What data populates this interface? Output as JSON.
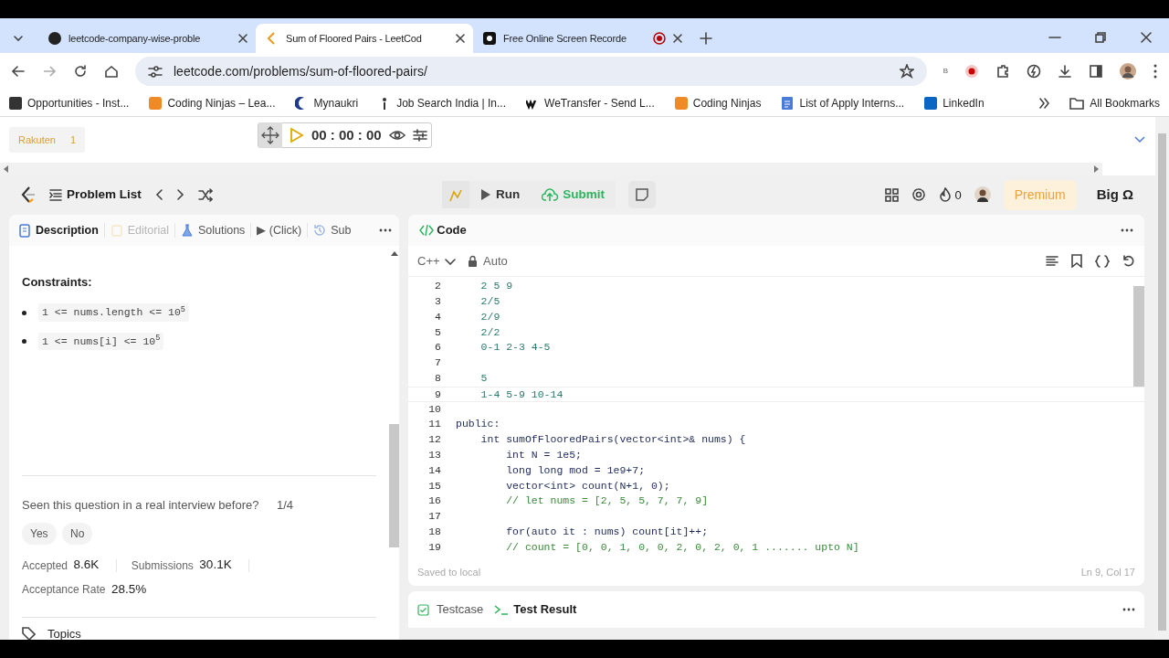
{
  "browser": {
    "tabs": [
      {
        "title": "leetcode-company-wise-proble",
        "selected": false
      },
      {
        "title": "Sum of Floored Pairs - LeetCod",
        "selected": true
      },
      {
        "title": "Free Online Screen Recorde",
        "selected": false
      }
    ],
    "url": "leetcode.com/problems/sum-of-floored-pairs/",
    "extension_badge": "B",
    "bookmarks": [
      "Opportunities - Inst...",
      "Coding Ninjas – Lea...",
      "Mynaukri",
      "Job Search India | In...",
      "WeTransfer - Send L...",
      "Coding Ninjas",
      "List of Apply Interns...",
      "LinkedIn"
    ],
    "all_bookmarks": "All Bookmarks"
  },
  "extension_bar": {
    "chip": {
      "label": "Rakuten",
      "count": "1"
    },
    "timer": "00 : 00 : 00"
  },
  "header": {
    "problem_list": "Problem List",
    "run": "Run",
    "submit": "Submit",
    "streak": "0",
    "premium": "Premium",
    "brand": "Big Ω"
  },
  "left_panel": {
    "tabs": [
      {
        "label": "Description",
        "selected": true,
        "disabled": false
      },
      {
        "label": "Editorial",
        "selected": false,
        "disabled": true
      },
      {
        "label": "Solutions",
        "selected": false,
        "disabled": false
      },
      {
        "label": "▶ (Click)",
        "selected": false,
        "disabled": false
      },
      {
        "label": "Sub",
        "selected": false,
        "disabled": false
      }
    ],
    "constraints_title": "Constraints:",
    "constraints": [
      "1 <= nums.length <= 10$^{5}$",
      "1 <= nums[i] <= 10$^{5}$"
    ],
    "interview_question": "Seen this question in a real interview before?",
    "interview_count": "1/4",
    "answers": [
      "Yes",
      "No"
    ],
    "stats": [
      {
        "label": "Accepted",
        "value": "8.6K"
      },
      {
        "label": "Submissions",
        "value": "30.1K"
      },
      {
        "label": "Acceptance Rate",
        "value": "28.5%"
      }
    ],
    "topics": "Topics"
  },
  "code_panel": {
    "title": "Code",
    "language": "C++",
    "mode": "Auto",
    "lines": [
      {
        "number": "2",
        "text": "    2 5 9",
        "kind": "note",
        "active": false
      },
      {
        "number": "3",
        "text": "    2/5",
        "kind": "note",
        "active": false
      },
      {
        "number": "4",
        "text": "    2/9",
        "kind": "note",
        "active": false
      },
      {
        "number": "5",
        "text": "    2/2",
        "kind": "note",
        "active": false
      },
      {
        "number": "6",
        "text": "    0-1 2-3 4-5",
        "kind": "note",
        "active": false
      },
      {
        "number": "7",
        "kind": "note",
        "active": false
      },
      {
        "number": "8",
        "text": "    5",
        "kind": "note",
        "active": false
      },
      {
        "number": "9",
        "text": "    1-4 5-9 10-14",
        "kind": "note",
        "active": true
      },
      {
        "number": "10",
        "kind": "code",
        "active": false
      },
      {
        "number": "11",
        "text": "public:",
        "kind": "code",
        "active": false
      },
      {
        "number": "12",
        "text": "    int sumOfFlooredPairs(vector<int>& nums) {",
        "kind": "code",
        "active": false
      },
      {
        "number": "13",
        "text": "        int N = 1e5;",
        "kind": "code",
        "active": false
      },
      {
        "number": "14",
        "text": "        long long mod = 1e9+7;",
        "kind": "code",
        "active": false
      },
      {
        "number": "15",
        "text": "        vector<int> count(N+1, 0);",
        "kind": "code",
        "active": false
      },
      {
        "number": "16",
        "text": "        // let nums = [2, 5, 5, 7, 7, 9]",
        "kind": "comment",
        "active": false
      },
      {
        "number": "17",
        "kind": "code",
        "active": false
      },
      {
        "number": "18",
        "text": "        for(auto it : nums) count[it]++;",
        "kind": "code",
        "active": false
      },
      {
        "number": "19",
        "text": "        // count = [0, 0, 1, 0, 0, 2, 0, 2, 0, 1 ....... upto N]",
        "kind": "comment",
        "active": false
      }
    ],
    "status": "Saved to local",
    "cursor": "Ln 9, Col 17"
  },
  "bottom_panel": {
    "tabs": [
      {
        "label": "Testcase",
        "selected": false
      },
      {
        "label": "Test Result",
        "selected": true
      }
    ]
  }
}
